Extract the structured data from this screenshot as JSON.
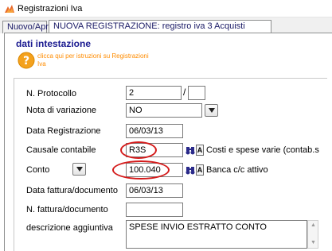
{
  "window": {
    "title": "Registrazioni Iva"
  },
  "tabs": [
    {
      "label": "Nuovo/Apri"
    },
    {
      "label": "NUOVA REGISTRAZIONE: registro iva 3 Acquisti"
    }
  ],
  "section": {
    "title": "dati intestazione",
    "help_text": "clicca qui per istruzioni su Registrazioni Iva"
  },
  "form": {
    "protocollo": {
      "label": "N. Protocollo",
      "value": "2",
      "suffix_value": "",
      "separator": "/"
    },
    "nota_variazione": {
      "label": "Nota di variazione",
      "value": "NO"
    },
    "data_registrazione": {
      "label": "Data Registrazione",
      "value": "06/03/13"
    },
    "causale": {
      "label": "Causale contabile",
      "value": "R3S",
      "description": "Costi e spese varie (contab.s"
    },
    "conto": {
      "label": "Conto",
      "value": "100.040",
      "description": "Banca c/c attivo"
    },
    "data_fattura": {
      "label": "Data fattura/documento",
      "value": "06/03/13"
    },
    "n_fattura": {
      "label": "N. fattura/documento",
      "value": ""
    },
    "descrizione": {
      "label": "descrizione aggiuntiva",
      "value": "SPESE INVIO ESTRATTO CONTO"
    },
    "a_button_label": "A"
  },
  "colors": {
    "accent": "#1a1a90",
    "help": "#ff8c00",
    "annotation": "#d41a1a"
  },
  "icons": [
    "app-icon",
    "help-icon",
    "chevron-down-icon",
    "binoculars-icon"
  ]
}
